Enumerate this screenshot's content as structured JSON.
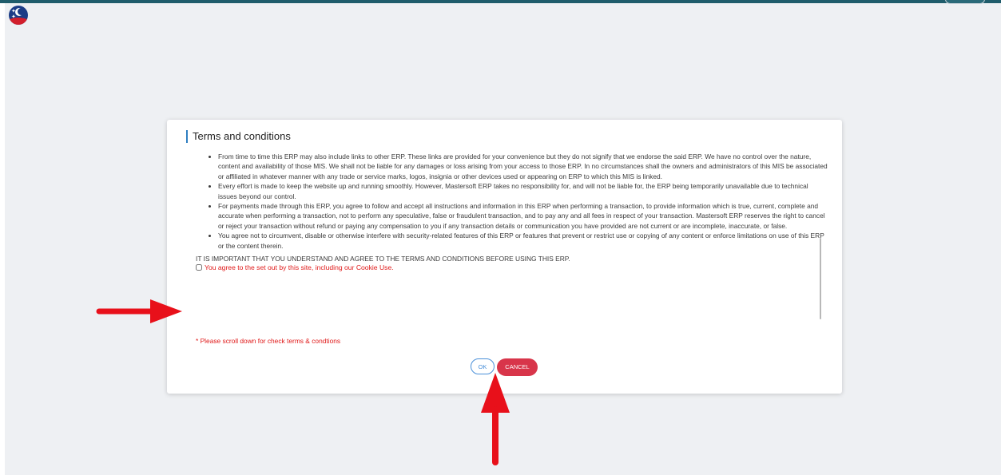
{
  "colors": {
    "topbar": "#1f5c6b",
    "accent_red": "#e01a1a",
    "ok_border": "#4a90d9",
    "cancel_bg": "#d8354a",
    "annotation_arrow": "#e8101a"
  },
  "logo": {
    "icon": "moon-stars-logo-icon"
  },
  "modal": {
    "title": "Terms and conditions",
    "terms": [
      "From time to time this ERP may also include links to other ERP. These links are provided for your convenience but they do not signify that we endorse the said ERP. We have no control over the nature, content and availability of those MIS. We shall not be liable for any damages or loss arising from your access to those ERP. In no circumstances shall the owners and administrators of this MIS be associated or affiliated in whatever manner with any trade or service marks, logos, insignia or other devices used or appearing on ERP to which this MIS is linked.",
      "Every effort is made to keep the website up and running smoothly. However, Mastersoft ERP takes no responsibility for, and will not be liable for, the ERP being temporarily unavailable due to technical issues beyond our control.",
      "For payments made through this ERP, you agree to follow and accept all instructions and information in this ERP when performing a transaction, to provide information which is true, current, complete and accurate when performing a transaction, not to perform any speculative, false or fraudulent transaction, and to pay any and all fees in respect of your transaction. Mastersoft ERP reserves the right to cancel or reject your transaction without refund or paying any compensation to you if any transaction details or communication you have provided are not current or are incomplete, inaccurate, or false.",
      "You agree not to circumvent, disable or otherwise interfere with security-related features of this ERP or features that prevent or restrict use or copying of any content or enforce limitations on use of this ERP or the content therein."
    ],
    "important_notice": "IT IS IMPORTANT THAT YOU UNDERSTAND AND AGREE TO THE TERMS AND CONDITIONS BEFORE USING THIS ERP.",
    "agree_label": "You agree to the set out by this site, including our Cookie Use.",
    "agree_checked": false,
    "scroll_note": "* Please scroll down for check terms & condtions",
    "ok_label": "OK",
    "cancel_label": "CANCEL"
  }
}
